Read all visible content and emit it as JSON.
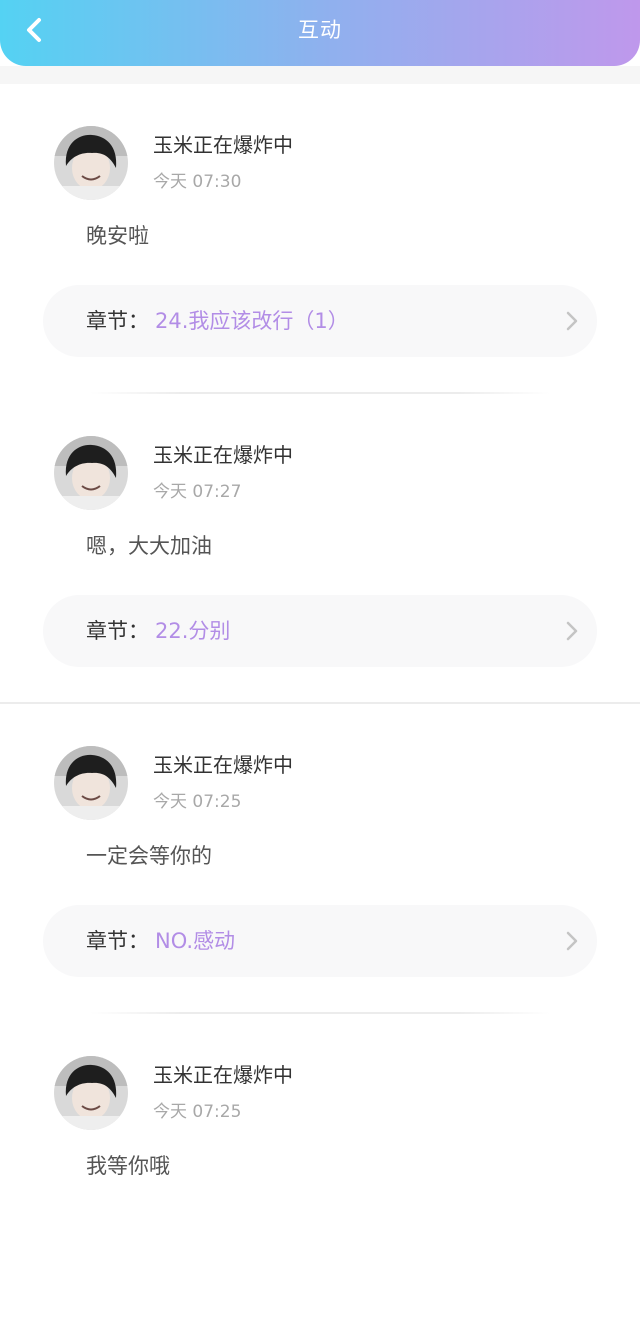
{
  "header": {
    "title": "互动",
    "back_icon": "chevron-left-icon"
  },
  "colors": {
    "header_gradient": [
      "#54d2f3",
      "#8eb1ee",
      "#bf98ec"
    ],
    "chapter_accent": "#b28de6"
  },
  "comments": [
    {
      "username": "玉米正在爆炸中",
      "time": "今天 07:30",
      "text": "晚安啦",
      "chapter_prefix": "章节：",
      "chapter_title": "24.我应该改行（1）"
    },
    {
      "username": "玉米正在爆炸中",
      "time": "今天 07:27",
      "text": "嗯，大大加油",
      "chapter_prefix": "章节：",
      "chapter_title": "22.分别"
    },
    {
      "username": "玉米正在爆炸中",
      "time": "今天 07:25",
      "text": "一定会等你的",
      "chapter_prefix": "章节：",
      "chapter_title": "NO.感动"
    },
    {
      "username": "玉米正在爆炸中",
      "time": "今天 07:25",
      "text": "我等你哦",
      "chapter_prefix": "",
      "chapter_title": ""
    }
  ]
}
